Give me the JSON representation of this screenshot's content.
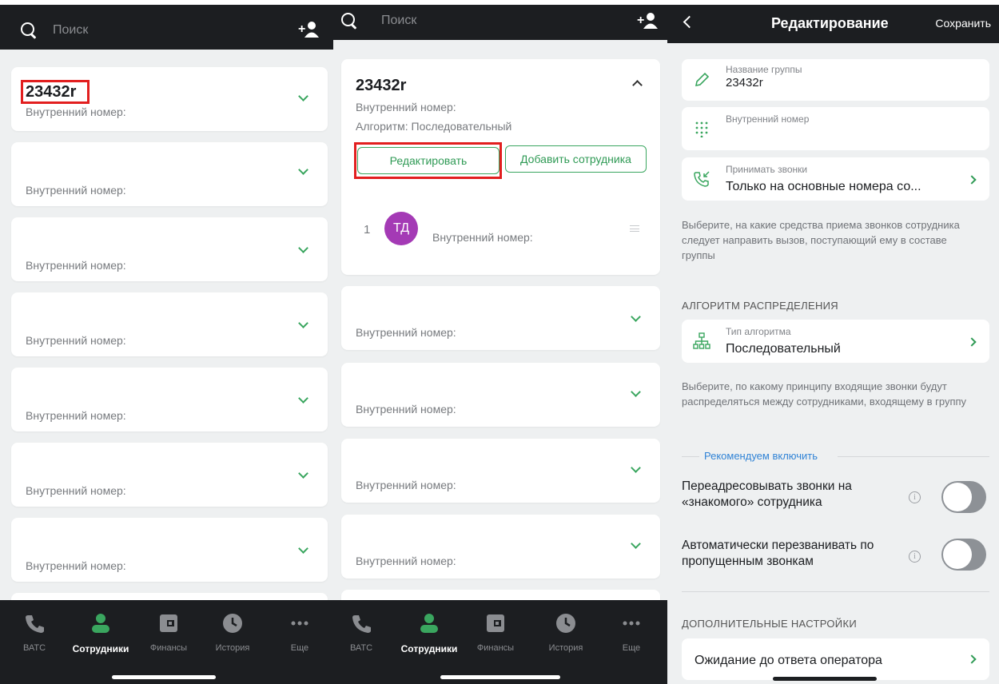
{
  "search": {
    "placeholder": "Поиск"
  },
  "group_list": {
    "subtitle_label": "Внутренний номер:",
    "first_group_name": "23432r"
  },
  "expanded_group": {
    "name": "23432r",
    "internal_number_label": "Внутренний номер:",
    "algorithm_line": "Алгоритм: Последовательный",
    "edit_button": "Редактировать",
    "add_employee_button": "Добавить сотрудника",
    "member": {
      "index": "1",
      "initials": "ТД",
      "internal_number_label": "Внутренний номер:"
    }
  },
  "tabbar": {
    "items": [
      {
        "label": "ВАТС",
        "icon": "phone-icon"
      },
      {
        "label": "Сотрудники",
        "icon": "person-icon",
        "active": true
      },
      {
        "label": "Финансы",
        "icon": "wallet-icon"
      },
      {
        "label": "История",
        "icon": "clock-icon"
      },
      {
        "label": "Еще",
        "icon": "more-icon"
      }
    ]
  },
  "edit": {
    "title": "Редактирование",
    "save": "Сохранить",
    "group_name_label": "Название группы",
    "group_name_value": "23432r",
    "internal_number_label": "Внутренний номер",
    "accept_calls_label": "Принимать звонки",
    "accept_calls_value": "Только на основные номера со...",
    "accept_calls_hint": "Выберите, на какие средства приема звонков сотрудника следует направить вызов, поступающий ему в составе группы",
    "algorithm_section": "АЛГОРИТМ РАСПРЕДЕЛЕНИЯ",
    "algorithm_type_label": "Тип алгоритма",
    "algorithm_type_value": "Последовательный",
    "algorithm_hint": "Выберите, по какому принципу входящие звонки будут распределяться между сотрудниками, входящему в группу",
    "recommend": "Рекомендуем включить",
    "toggle_forward": "Переадресовывать звонки на «знакомого» сотрудника",
    "toggle_callback": "Автоматически перезванивать по пропущенным звонкам",
    "extra_section": "ДОПОЛНИТЕЛЬНЫЕ НАСТРОЙКИ",
    "wait_setting": "Ожидание до ответа оператора"
  },
  "colors": {
    "accent": "#3aa65f",
    "dark": "#1c1e21",
    "link": "#3284d6",
    "avatar": "#a43ab5",
    "highlight": "#e21f1f"
  }
}
